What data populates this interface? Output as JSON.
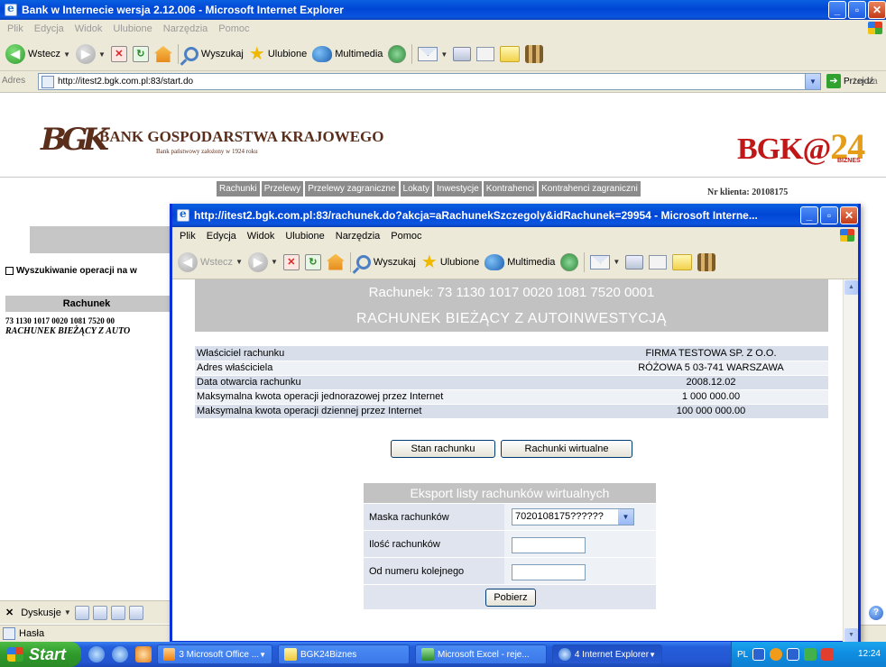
{
  "main_window": {
    "title": "Bank w Internecie wersja 2.12.006 - Microsoft Internet Explorer",
    "menu": [
      "Plik",
      "Edycja",
      "Widok",
      "Ulubione",
      "Narzędzia",
      "Pomoc"
    ],
    "toolbar": {
      "back": "Wstecz",
      "search": "Wyszukaj",
      "favorites": "Ulubione",
      "media": "Multimedia"
    },
    "address_label": "Adres",
    "address": "http://itest2.bgk.com.pl:83/start.do",
    "go_label": "Przejdź",
    "links_label": "Łącza"
  },
  "bank": {
    "monogram": "BGK",
    "name": "BANK GOSPODARSTWA KRAJOWEGO",
    "subtitle": "Bank państwowy założony w 1924 roku",
    "brand_left": "BGK@",
    "brand_num": "24",
    "brand_sub": "BIZNES"
  },
  "nav": {
    "tabs": [
      "Rachunki",
      "Przelewy",
      "Przelewy zagraniczne",
      "Lokaty",
      "Inwestycje",
      "Kontrahenci",
      "Kontrahenci zagraniczni"
    ],
    "client": "Nr klienta: 20108175"
  },
  "left_panel": {
    "search_title": "Wyszukiwanie operacji na w",
    "table_header": "Rachunek",
    "account_number": "73 1130 1017 0020 1081 7520 00",
    "account_name": "RACHUNEK BIEŻĄCY Z AUTO"
  },
  "bottom": {
    "dyskusje": "Dyskusje",
    "status_text": "Hasła"
  },
  "popup": {
    "title": "http://itest2.bgk.com.pl:83/rachunek.do?akcja=aRachunekSzczegoly&idRachunek=29954 - Microsoft Interne...",
    "menu": [
      "Plik",
      "Edycja",
      "Widok",
      "Ulubione",
      "Narzędzia",
      "Pomoc"
    ],
    "toolbar": {
      "back": "Wstecz",
      "search": "Wyszukaj",
      "favorites": "Ulubione",
      "media": "Multimedia"
    },
    "account_title": "Rachunek: 73 1130 1017 0020 1081 7520 0001",
    "account_type": "RACHUNEK BIEŻĄCY Z AUTOINWESTYCJĄ",
    "details": [
      {
        "label": "Właściciel rachunku",
        "value": "FIRMA TESTOWA SP. Z O.O."
      },
      {
        "label": "Adres właściciela",
        "value": "RÓŻOWA 5 03-741 WARSZAWA"
      },
      {
        "label": "Data otwarcia rachunku",
        "value": "2008.12.02"
      },
      {
        "label": "Maksymalna kwota operacji jednorazowej przez Internet",
        "value": "1 000 000.00"
      },
      {
        "label": "Maksymalna kwota operacji dziennej przez Internet",
        "value": "100 000 000.00"
      }
    ],
    "buttons": {
      "balance": "Stan rachunku",
      "virtual": "Rachunki wirtualne"
    },
    "export": {
      "title": "Eksport listy rachunków wirtualnych",
      "mask_label": "Maska rachunków",
      "mask_value": "7020108175??????",
      "count_label": "Ilość rachunków",
      "count_value": "",
      "from_label": "Od numeru kolejnego",
      "from_value": "",
      "download": "Pobierz"
    }
  },
  "taskbar": {
    "start": "Start",
    "tasks": [
      "3 Microsoft Office ...",
      "BGK24Biznes",
      "Microsoft Excel - reje...",
      "4 Internet Explorer"
    ],
    "lang": "PL",
    "time": "12:24"
  }
}
